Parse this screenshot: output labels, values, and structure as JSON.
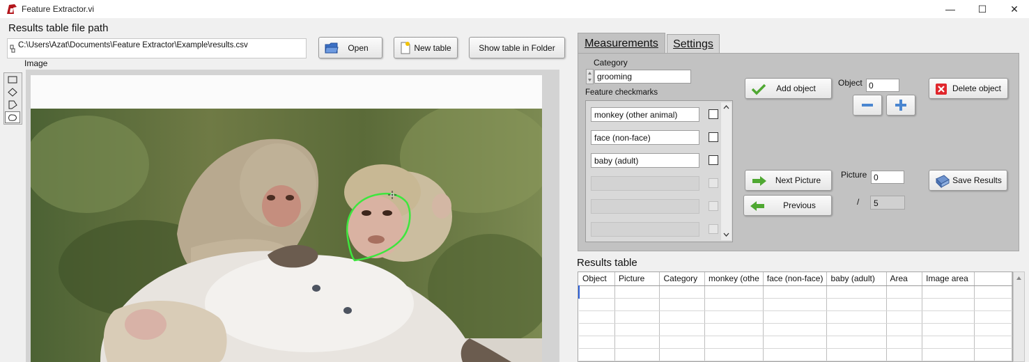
{
  "window": {
    "title": "Feature Extractor.vi",
    "minimize_glyph": "—",
    "maximize_glyph": "☐",
    "close_glyph": "✕"
  },
  "path": {
    "label": "Results table file path",
    "value": "C:\\Users\\Azat\\Documents\\Feature Extractor\\Example\\results.csv"
  },
  "buttons": {
    "open": "Open",
    "new_table": "New table",
    "show_in_folder": "Show table in Folder",
    "add_object": "Add object",
    "delete_object": "Delete object",
    "next_picture": "Next Picture",
    "previous": "Previous",
    "save_results": "Save Results"
  },
  "image": {
    "label": "Image",
    "tools": [
      "rectangle-tool-icon",
      "rotated-rectangle-tool-icon",
      "polygon-tool-icon",
      "freehand-tool-icon"
    ]
  },
  "tabs": [
    {
      "label": "Measurements",
      "active": true
    },
    {
      "label": "Settings",
      "active": false
    }
  ],
  "measurements": {
    "category_label": "Category",
    "category_value": "grooming",
    "checkmarks_label": "Feature checkmarks",
    "checkmarks": [
      {
        "label": "monkey (other animal)",
        "checked": false,
        "enabled": true
      },
      {
        "label": "face (non-face)",
        "checked": false,
        "enabled": true
      },
      {
        "label": "baby (adult)",
        "checked": false,
        "enabled": true
      },
      {
        "label": "",
        "checked": false,
        "enabled": false
      },
      {
        "label": "",
        "checked": false,
        "enabled": false
      },
      {
        "label": "",
        "checked": false,
        "enabled": false
      }
    ],
    "object_label": "Object",
    "object_value": "0",
    "picture_label": "Picture",
    "picture_value": "0",
    "slash": "/",
    "picture_total": "5"
  },
  "results": {
    "label": "Results table",
    "columns": [
      "Object",
      "Picture",
      "Category",
      "monkey (othe",
      "face (non-face)",
      "baby (adult)",
      "Area",
      "Image area",
      ""
    ],
    "rows": 6
  },
  "colors": {
    "panel": "#c2c2c2",
    "contour": "#3ee63e",
    "delete_red": "#e0262c",
    "arrow_green": "#4fa832",
    "plus_blue": "#4a86d0"
  }
}
